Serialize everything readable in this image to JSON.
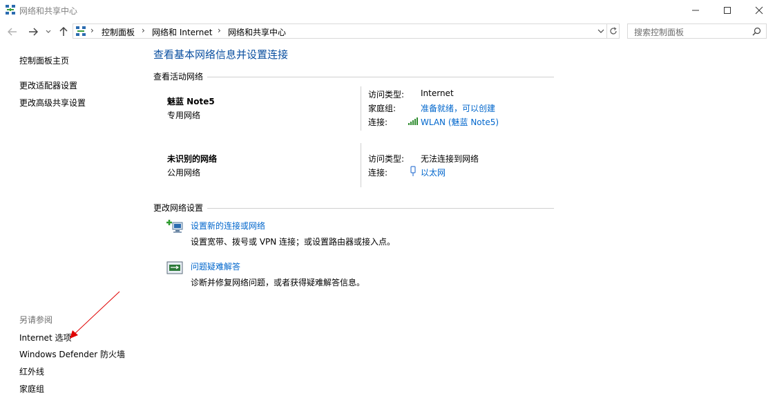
{
  "window": {
    "title": "网络和共享中心",
    "controls": {
      "minimize": "—",
      "maximize": "☐",
      "close": "✕"
    }
  },
  "nav": {
    "breadcrumb": [
      "控制面板",
      "网络和 Internet",
      "网络和共享中心"
    ],
    "search_placeholder": "搜索控制面板"
  },
  "sidebar": {
    "home": "控制面板主页",
    "links": [
      "更改适配器设置",
      "更改高级共享设置"
    ],
    "see_also_title": "另请参阅",
    "see_also": [
      "Internet 选项",
      "Windows Defender 防火墙",
      "红外线",
      "家庭组"
    ]
  },
  "main": {
    "heading": "查看基本网络信息并设置连接",
    "active_networks_title": "查看活动网络",
    "networks": [
      {
        "name": "魅蓝 Note5",
        "type": "专用网络",
        "access_label": "访问类型:",
        "access_value": "Internet",
        "homegroup_label": "家庭组:",
        "homegroup_value": "准备就绪，可以创建",
        "connection_label": "连接:",
        "connection_value": "WLAN (魅蓝 Note5)",
        "connection_icon": "wifi-signal-icon"
      },
      {
        "name": "未识别的网络",
        "type": "公用网络",
        "access_label": "访问类型:",
        "access_value": "无法连接到网络",
        "connection_label": "连接:",
        "connection_value": "以太网",
        "connection_icon": "ethernet-icon"
      }
    ],
    "change_settings_title": "更改网络设置",
    "tasks": [
      {
        "title": "设置新的连接或网络",
        "desc": "设置宽带、拨号或 VPN 连接；或设置路由器或接入点。",
        "icon": "new-connection-icon"
      },
      {
        "title": "问题疑难解答",
        "desc": "诊断并修复网络问题，或者获得疑难解答信息。",
        "icon": "troubleshoot-icon"
      }
    ]
  },
  "colors": {
    "link": "#0066cc",
    "annotation_arrow": "#e00000"
  }
}
